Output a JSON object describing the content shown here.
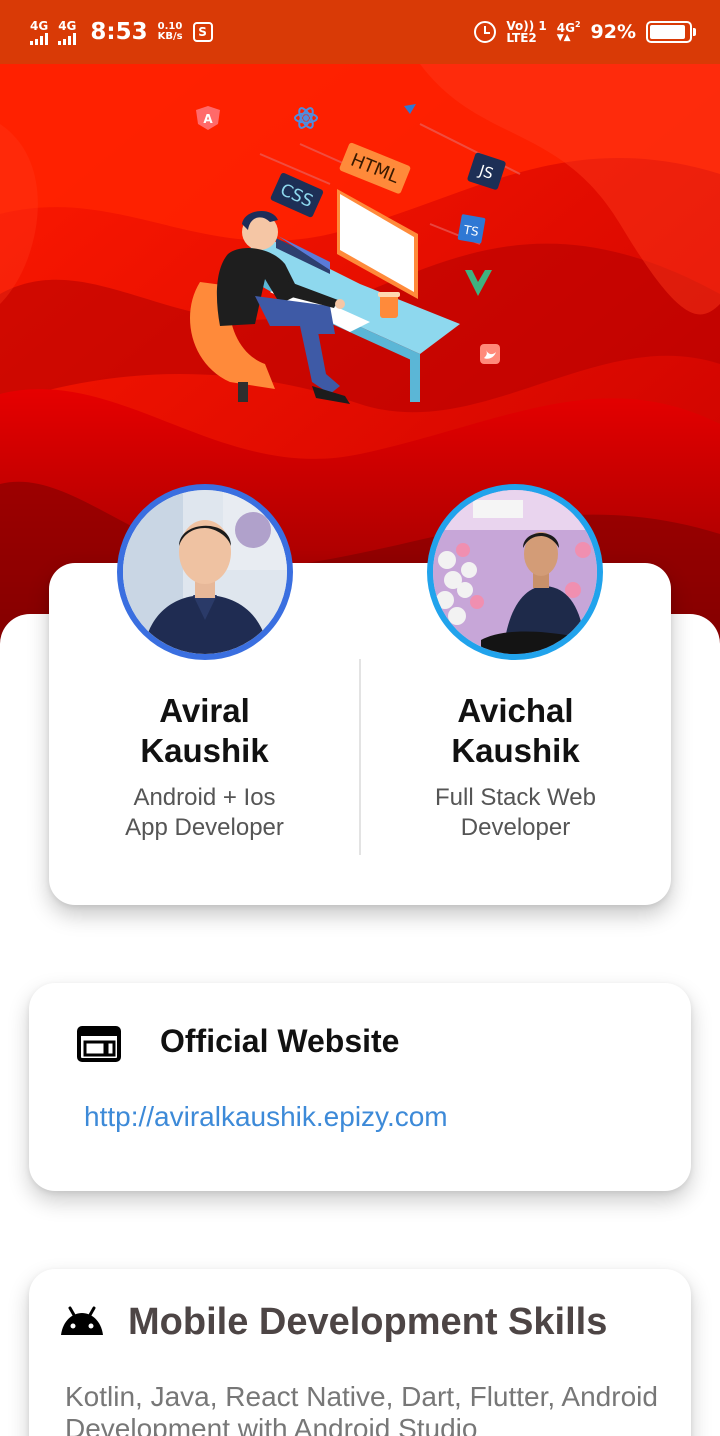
{
  "status_bar": {
    "sim1": "4G",
    "sim2": "4G",
    "time": "8:53",
    "speed_value": "0.10",
    "speed_unit": "KB/s",
    "volte_top": "Vo)) 1",
    "volte_bottom": "LTE2",
    "net_top": "4G",
    "net_sub": "2",
    "battery": "92%",
    "battery_level": 0.92,
    "background": "#d93a06"
  },
  "hero": {
    "tech_labels": [
      "HTML",
      "CSS",
      "JS",
      "TS",
      "A"
    ],
    "background": "#d10000"
  },
  "profiles": [
    {
      "name": "Aviral Kaushik",
      "name_line1": "Aviral",
      "name_line2": "Kaushik",
      "role_line1": "Android + Ios",
      "role_line2": "App Developer",
      "ring_color": "#3a6fe0"
    },
    {
      "name": "Avichal Kaushik",
      "name_line1": "Avichal",
      "name_line2": "Kaushik",
      "role_line1": "Full Stack Web",
      "role_line2": "Developer",
      "ring_color": "#21a3ec"
    }
  ],
  "website": {
    "icon": "web-window-icon",
    "title": "Official Website",
    "url": "http://aviralkaushik.epizy.com",
    "link_color": "#3d8ad8"
  },
  "skills": {
    "icon": "android-icon",
    "title": "Mobile Development Skills",
    "text": "Kotlin, Java, React Native, Dart, Flutter, Android Development with Android Studio"
  }
}
